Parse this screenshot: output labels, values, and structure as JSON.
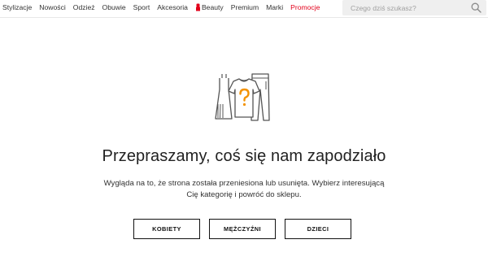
{
  "nav": {
    "items": [
      {
        "label": "Stylizacje"
      },
      {
        "label": "Nowości"
      },
      {
        "label": "Odzież"
      },
      {
        "label": "Obuwie"
      },
      {
        "label": "Sport"
      },
      {
        "label": "Akcesoria"
      },
      {
        "label": "Beauty",
        "icon": "lipstick-icon"
      },
      {
        "label": "Premium"
      },
      {
        "label": "Marki"
      },
      {
        "label": "Promocje",
        "color": "#e2001a"
      }
    ]
  },
  "search": {
    "placeholder": "Czego dziś szukasz?",
    "icon": "search-icon"
  },
  "main": {
    "illustration_icon": "clothes-question-icon",
    "accent_color": "#f39200",
    "title": "Przepraszamy, coś się nam zapodziało",
    "description_line1": "Wygląda na to, że strona została przeniesiona lub usunięta. Wybierz interesującą",
    "description_line2": "Cię kategorię i powróć do sklepu."
  },
  "buttons": [
    {
      "label": "KOBIETY"
    },
    {
      "label": "MĘŻCZYŹNI"
    },
    {
      "label": "DZIECI"
    }
  ]
}
